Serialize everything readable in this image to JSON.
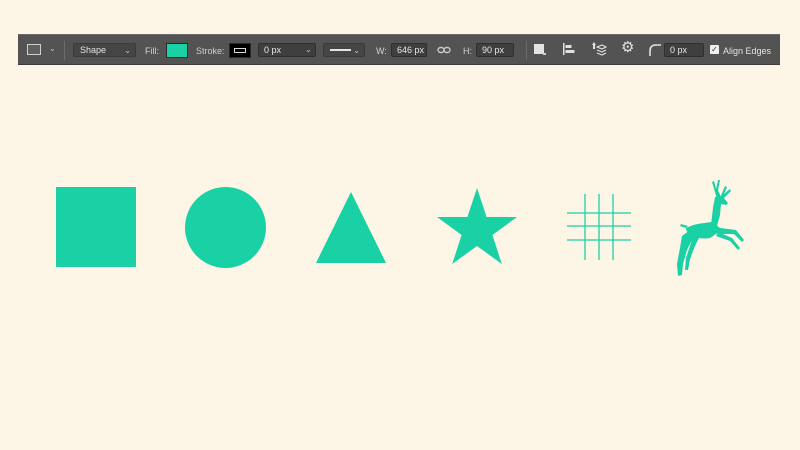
{
  "toolbar": {
    "tool_icon": "rectangle-tool-icon",
    "mode": "Shape",
    "fill_label": "Fill:",
    "fill_color": "#1ad1a5",
    "stroke_label": "Stroke:",
    "stroke_color": "#000000",
    "stroke_width": "0 px",
    "stroke_style_icon": "stroke-style-line-icon",
    "width_label": "W:",
    "width_value": "646 px",
    "link_icon": "link-dimensions-icon",
    "height_label": "H:",
    "height_value": "90 px",
    "path_operations_icon": "path-operations-icon",
    "path_alignment_icon": "path-alignment-icon",
    "path_arrangement_icon": "path-arrangement-icon",
    "settings_icon": "gear-icon",
    "corner_radius_icon": "corner-radius-icon",
    "corner_radius": "0 px",
    "align_edges_label": "Align Edges",
    "align_edges_checked": true
  },
  "canvas": {
    "background_color": "#fdf5e6",
    "shape_color": "#1ad1a5",
    "shapes": [
      "square",
      "circle",
      "triangle",
      "star",
      "grid",
      "deer"
    ]
  }
}
